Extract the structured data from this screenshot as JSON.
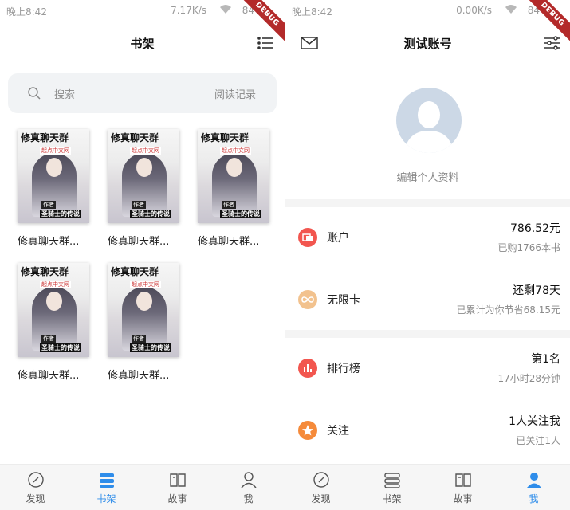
{
  "status_left": {
    "time": "晚上8:42",
    "speed": "7.17K/s",
    "battery": "84",
    "debug": "DEBUG"
  },
  "status_right": {
    "time": "晚上8:42",
    "speed": "0.00K/s",
    "battery": "84",
    "debug": "DEBUG"
  },
  "bookshelf": {
    "title": "书架",
    "search_placeholder": "搜索",
    "history_label": "阅读记录",
    "cover_title": "修真聊天群",
    "cover_badge": "起点中文网",
    "cover_author_tag": "作者",
    "cover_author": "圣骑士的传说",
    "books": [
      {
        "name": "修真聊天群..."
      },
      {
        "name": "修真聊天群..."
      },
      {
        "name": "修真聊天群..."
      },
      {
        "name": "修真聊天群..."
      },
      {
        "name": "修真聊天群..."
      }
    ]
  },
  "profile": {
    "title": "测试账号",
    "edit_label": "编辑个人资料",
    "rows": [
      {
        "label": "账户",
        "main": "786.52元",
        "sub": "已购1766本书",
        "icon": "wallet-icon",
        "color": "#f2564f"
      },
      {
        "label": "无限卡",
        "main": "还剩78天",
        "sub": "已累计为你节省68.15元",
        "icon": "infinity-icon",
        "color": "#f2c28e"
      },
      {
        "label": "排行榜",
        "main": "第1名",
        "sub": "17小时28分钟",
        "icon": "bar-chart-icon",
        "color": "#f2564f"
      },
      {
        "label": "关注",
        "main": "1人关注我",
        "sub": "已关注1人",
        "icon": "star-icon",
        "color": "#f58a3a"
      }
    ]
  },
  "nav": [
    {
      "label": "发现",
      "icon": "compass-icon"
    },
    {
      "label": "书架",
      "icon": "bookshelf-icon"
    },
    {
      "label": "故事",
      "icon": "book-open-icon"
    },
    {
      "label": "我",
      "icon": "person-icon"
    }
  ],
  "colors": {
    "accent": "#2f8dea",
    "debug": "#b32a2a",
    "search_bg": "#f1f3f5"
  }
}
